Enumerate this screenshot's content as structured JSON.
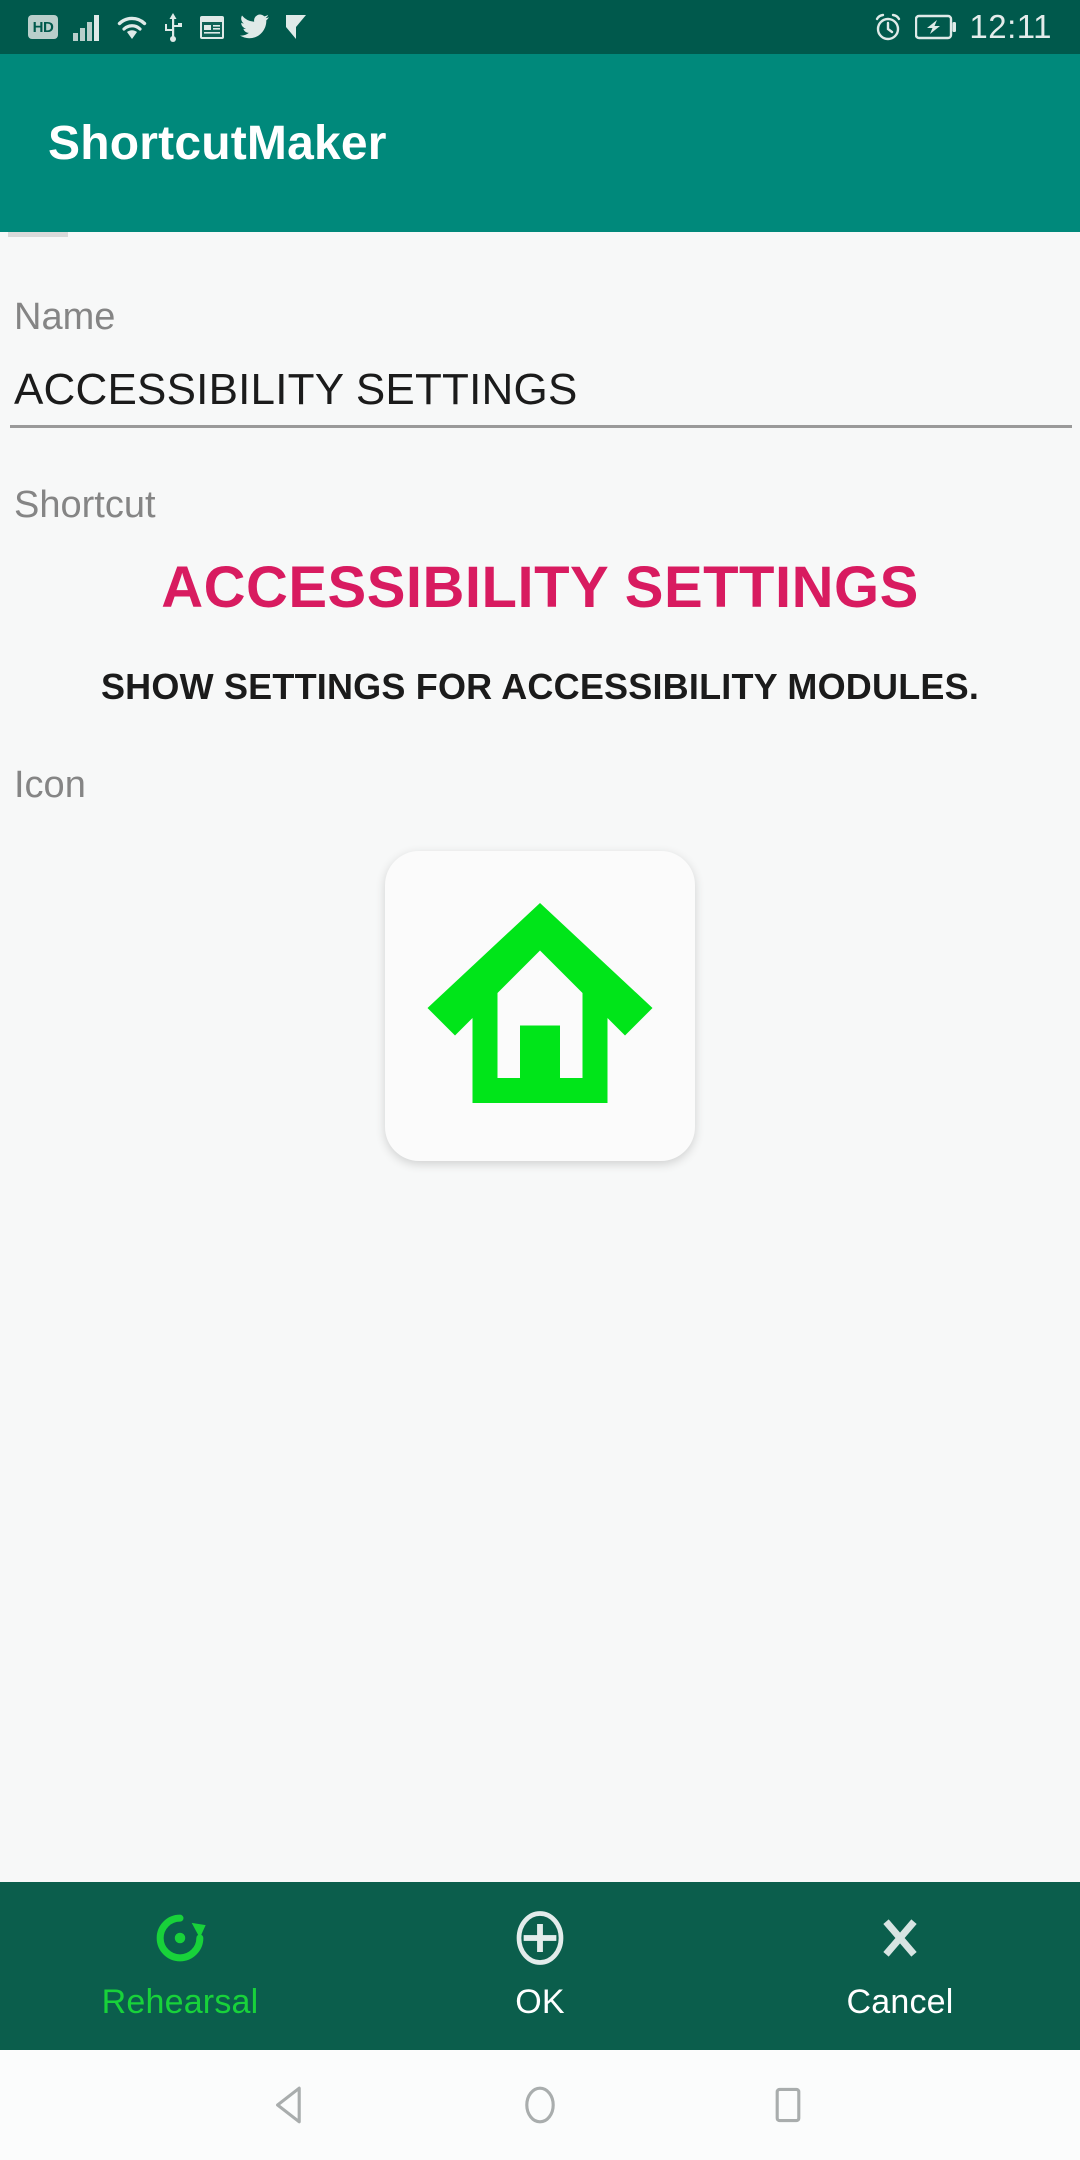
{
  "status_bar": {
    "time": "12:11",
    "left_icons": [
      {
        "name": "hd-icon",
        "label": "HD"
      },
      {
        "name": "signal-bars-icon",
        "label": ""
      },
      {
        "name": "wifi-icon",
        "label": ""
      },
      {
        "name": "usb-icon",
        "label": ""
      },
      {
        "name": "calendar-icon",
        "label": ""
      },
      {
        "name": "twitter-icon",
        "label": ""
      },
      {
        "name": "flipboard-icon",
        "label": ""
      }
    ],
    "right_icons": [
      {
        "name": "alarm-clock-icon",
        "label": ""
      },
      {
        "name": "battery-charging-icon",
        "label": ""
      }
    ],
    "background": "#00594c"
  },
  "app_bar": {
    "title": "ShortcutMaker",
    "background": "#00897b",
    "title_color": "#ffffff"
  },
  "form": {
    "name_label": "Name",
    "name_value": "ACCESSIBILITY SETTINGS",
    "name_placeholder": "Name",
    "shortcut_label": "Shortcut",
    "icon_label": "Icon"
  },
  "shortcut_preview": {
    "title": "ACCESSIBILITY SETTINGS",
    "title_color": "#d81b60",
    "description": "SHOW SETTINGS FOR ACCESSIBILITY MODULES.",
    "description_color": "#1b1b1b"
  },
  "icon_preview": {
    "icon_name": "home-house-icon",
    "icon_color": "#00e519",
    "tile_background": "#fbfbfb"
  },
  "bottom_bar": {
    "background": "#0b5e4c",
    "items": [
      {
        "name": "rehearsal",
        "label": "Rehearsal",
        "icon": "refresh-icon",
        "color": "#18d23a",
        "active": true
      },
      {
        "name": "ok",
        "label": "OK",
        "icon": "plus-circle-icon",
        "color": "#ffffff",
        "active": false
      },
      {
        "name": "cancel",
        "label": "Cancel",
        "icon": "close-x-icon",
        "color": "#ffffff",
        "active": false
      }
    ]
  },
  "nav_bar": {
    "background": "#fbfcfc",
    "buttons": [
      {
        "name": "back-button",
        "icon": "back-triangle-icon"
      },
      {
        "name": "home-button",
        "icon": "home-circle-icon"
      },
      {
        "name": "recents-button",
        "icon": "recents-square-icon"
      }
    ]
  }
}
